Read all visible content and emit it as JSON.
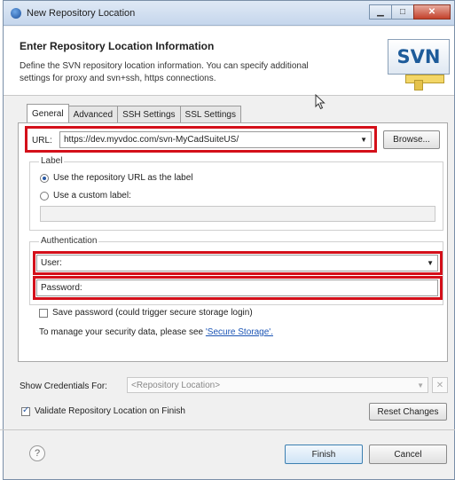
{
  "window": {
    "title": "New Repository Location"
  },
  "header": {
    "title": "Enter Repository Location Information",
    "description": "Define the SVN repository location information. You can specify additional settings for proxy and svn+ssh, https connections.",
    "logo_text": "SVN"
  },
  "tabs": [
    {
      "label": "General",
      "active": true
    },
    {
      "label": "Advanced",
      "active": false
    },
    {
      "label": "SSH Settings",
      "active": false
    },
    {
      "label": "SSL Settings",
      "active": false
    }
  ],
  "general": {
    "url_label": "URL:",
    "url_value": "https://dev.myvdoc.com/svn-MyCadSuiteUS/",
    "browse_label": "Browse...",
    "label_group": {
      "title": "Label",
      "use_url_label": "Use the repository URL as the label",
      "use_custom_label": "Use a custom label:",
      "selected": "use_url"
    },
    "auth_group": {
      "title": "Authentication",
      "user_label": "User:",
      "password_label": "Password:"
    },
    "save_password_label": "Save password (could trigger secure storage login)",
    "save_password_checked": false,
    "security_text": "To manage your security data, please see",
    "security_link": "'Secure Storage'."
  },
  "credentials": {
    "label": "Show Credentials For:",
    "placeholder": "<Repository Location>",
    "delete_label": "✕"
  },
  "validate": {
    "label": "Validate Repository Location on Finish",
    "checked": true
  },
  "buttons": {
    "reset": "Reset Changes",
    "finish": "Finish",
    "cancel": "Cancel",
    "help": "?"
  },
  "colors": {
    "highlight": "#d4101a",
    "accent": "#1d5b9a"
  }
}
